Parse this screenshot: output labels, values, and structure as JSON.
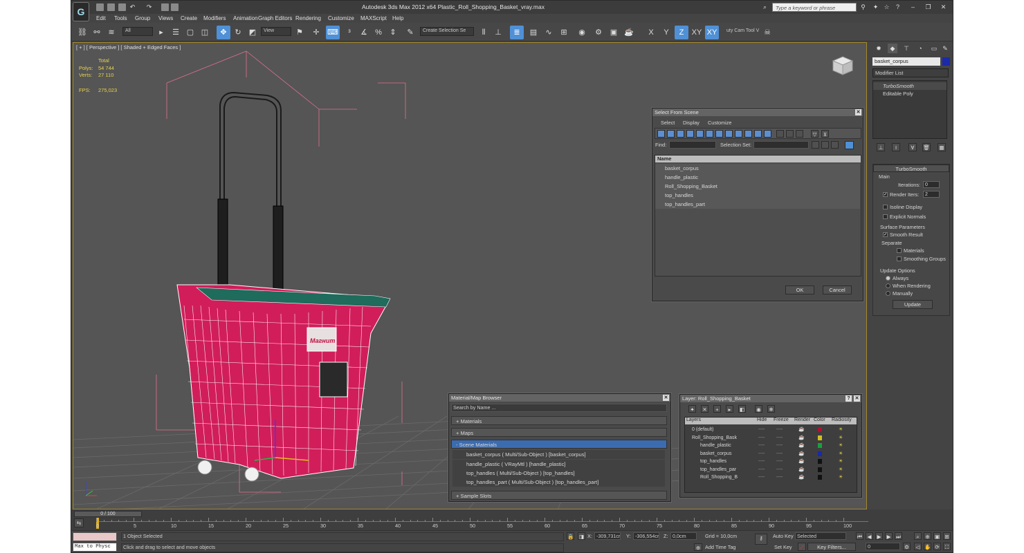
{
  "window": {
    "title": "Autodesk 3ds Max  2012 x64      Plastic_Roll_Shopping_Basket_vray.max",
    "search_placeholder": "Type a keyword or phrase"
  },
  "menu": [
    "Edit",
    "Tools",
    "Group",
    "Views",
    "Create",
    "Modifiers",
    "Animation",
    "Graph Editors",
    "Rendering",
    "Customize",
    "MAXScript",
    "Help"
  ],
  "toolbar": {
    "selection_filter": "All",
    "ref_coord": "View",
    "named_selection": "Create Selection Se",
    "axis_x": "X",
    "axis_y": "Y",
    "axis_z": "Z",
    "axis_xy": "XY",
    "axis_xy2": "XY",
    "cam_tool": "uty Cam Tool V"
  },
  "viewport": {
    "label": "[ + ] [ Perspective ] [ Shaded + Edged Faces ]",
    "stats_header": "Total",
    "polys_label": "Polys:",
    "polys_value": "54 744",
    "verts_label": "Verts:",
    "verts_value": "27 110",
    "fps_label": "FPS:",
    "fps_value": "275,023",
    "logo_text": "Магнит"
  },
  "command_panel": {
    "object_name": "basket_corpus",
    "object_color": "#1a2aa8",
    "modifier_list": "Modifier List",
    "stack": [
      "TurboSmooth",
      "Editable Poly"
    ],
    "rollout_title": "TurboSmooth",
    "main_label": "Main",
    "iterations_label": "Iterations:",
    "iterations_value": "0",
    "render_iters_label": "Render Iters:",
    "render_iters_value": "2",
    "isoline_label": "Isoline Display",
    "explicit_label": "Explicit Normals",
    "surface_label": "Surface Parameters",
    "smooth_result_label": "Smooth Result",
    "separate_label": "Separate",
    "materials_label": "Materials",
    "smoothing_groups_label": "Smoothing Groups",
    "update_options_label": "Update Options",
    "always_label": "Always",
    "when_rendering_label": "When Rendering",
    "manually_label": "Manually",
    "update_button": "Update"
  },
  "select_from_scene": {
    "title": "Select From Scene",
    "menu": [
      "Select",
      "Display",
      "Customize"
    ],
    "find_label": "Find:",
    "selection_set_label": "Selection Set:",
    "column_name": "Name",
    "items": [
      "basket_corpus",
      "handle_plastic",
      "Roll_Shopping_Basket",
      "top_handles",
      "top_handles_part"
    ],
    "ok": "OK",
    "cancel": "Cancel"
  },
  "material_browser": {
    "title": "Material/Map Browser",
    "search_placeholder": "Search by Name ...",
    "sections": [
      "+ Materials",
      "+ Maps",
      "- Scene Materials",
      "+ Sample Slots"
    ],
    "scene_materials": [
      "basket_corpus  ( Multi/Sub-Object ) [basket_corpus]",
      "handle_plastic  ( VRayMtl ) [handle_plastic]",
      "top_handles  ( Multi/Sub-Object ) [top_handles]",
      "top_handles_part  ( Multi/Sub-Object ) [top_handles_part]"
    ]
  },
  "layer_manager": {
    "title": "Layer: Roll_Shopping_Basket",
    "columns": [
      "Layers",
      "Hide",
      "Freeze",
      "Render",
      "Color",
      "Radiosity"
    ],
    "rows": [
      {
        "name": "0 (default)",
        "color": "#b01030"
      },
      {
        "name": "Roll_Shopping_Bask",
        "color": "#d0c020"
      },
      {
        "name": "handle_plastic",
        "color": "#18a040"
      },
      {
        "name": "basket_corpus",
        "color": "#1a2aa8"
      },
      {
        "name": "top_handles",
        "color": "#111111"
      },
      {
        "name": "top_handles_par",
        "color": "#111111"
      },
      {
        "name": "Roll_Shopping_B",
        "color": "#111111"
      }
    ]
  },
  "timeline": {
    "frame_range": "0 / 100",
    "ticks": [
      "0",
      "5",
      "10",
      "15",
      "20",
      "25",
      "30",
      "35",
      "40",
      "45",
      "50",
      "55",
      "60",
      "65",
      "70",
      "75",
      "80",
      "85",
      "90",
      "95",
      "100"
    ]
  },
  "status": {
    "maxscript_label": "Max to Physc",
    "selection_info": "1 Object Selected",
    "prompt": "Click and drag to select and move objects",
    "x_label": "X:",
    "x_value": "-309,731cr",
    "y_label": "Y:",
    "y_value": "-306,554cr",
    "z_label": "Z:",
    "z_value": "0,0cm",
    "grid": "Grid = 10,0cm",
    "add_time_tag": "Add Time Tag",
    "auto_key": "Auto Key",
    "set_key": "Set Key",
    "key_mode": "Selected",
    "key_filters": "Key Filters...",
    "frame": "0"
  }
}
